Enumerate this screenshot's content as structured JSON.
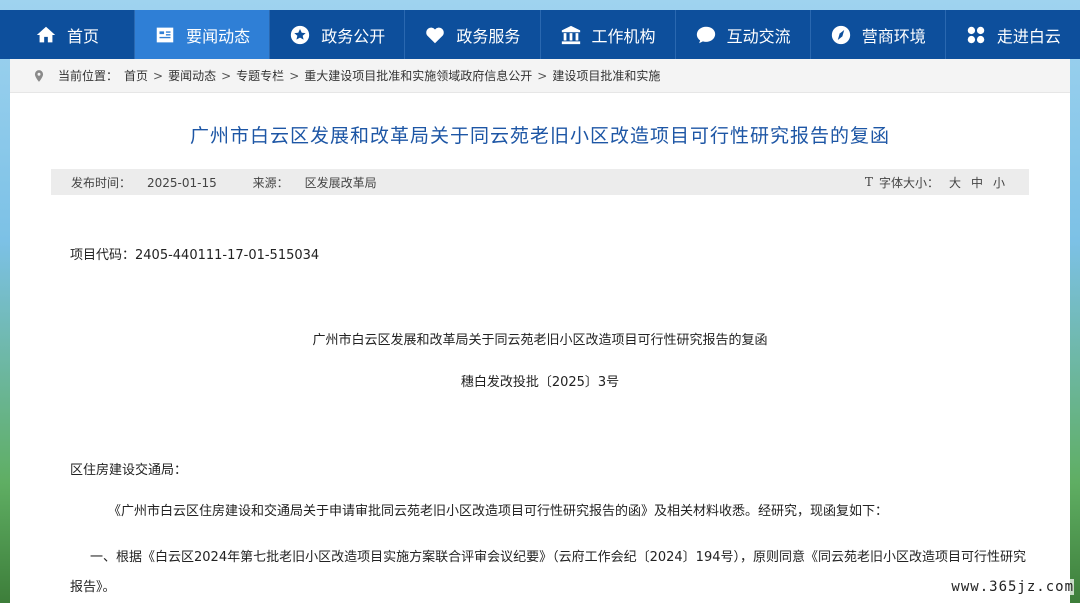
{
  "nav": {
    "items": [
      {
        "label": "首页",
        "icon": "home-icon"
      },
      {
        "label": "要闻动态",
        "icon": "news-icon"
      },
      {
        "label": "政务公开",
        "icon": "star-icon"
      },
      {
        "label": "政务服务",
        "icon": "heart-icon"
      },
      {
        "label": "工作机构",
        "icon": "building-icon"
      },
      {
        "label": "互动交流",
        "icon": "chat-icon"
      },
      {
        "label": "营商环境",
        "icon": "compass-icon"
      },
      {
        "label": "走进白云",
        "icon": "grid-icon"
      }
    ],
    "active_index": 1,
    "bar_color": "#0d4f9c",
    "active_color": "#2f7fd6"
  },
  "breadcrumb": {
    "prefix": "当前位置：",
    "items": [
      "首页",
      "要闻动态",
      "专题专栏",
      "重大建设项目批准和实施领域政府信息公开",
      "建设项目批准和实施"
    ]
  },
  "article": {
    "title": "广州市白云区发展和改革局关于同云苑老旧小区改造项目可行性研究报告的复函",
    "publish_label": "发布时间：",
    "publish_date": "2025-01-15",
    "source_label": "来源：",
    "source": "区发展改革局",
    "font_size_label": "字体大小：",
    "font_sizes": [
      "大",
      "中",
      "小"
    ],
    "project_code": "项目代码：2405-440111-17-01-515034",
    "doc_title": "广州市白云区发展和改革局关于同云苑老旧小区改造项目可行性研究报告的复函",
    "doc_number": "穗白发改投批〔2025〕3号",
    "addressee": "区住房建设交通局：",
    "para1": "《广州市白云区住房建设和交通局关于申请审批同云苑老旧小区改造项目可行性研究报告的函》及相关材料收悉。经研究，现函复如下：",
    "para2": "一、根据《白云区2024年第七批老旧小区改造项目实施方案联合评审会议纪要》（云府工作会纪〔2024〕194号），原则同意《同云苑老旧小区改造项目可行性研究报告》。"
  },
  "watermark": "www.365jz.com"
}
